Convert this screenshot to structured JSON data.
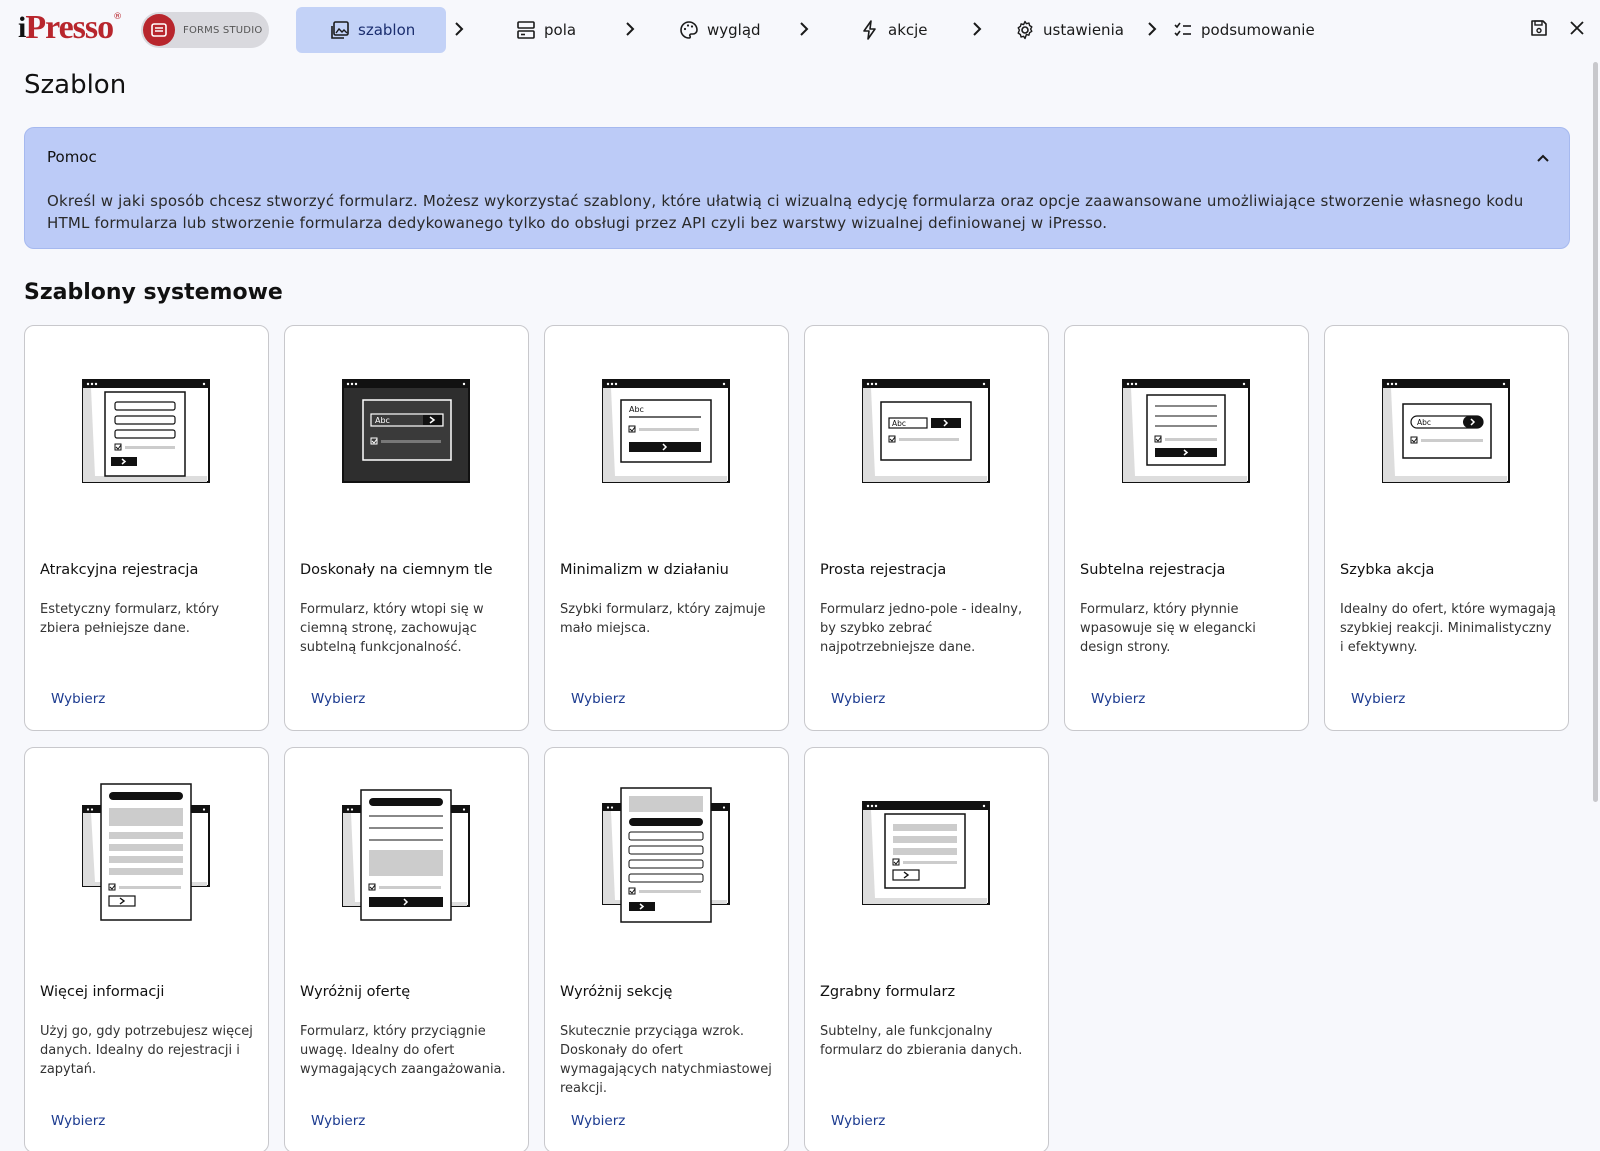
{
  "brand": {
    "logo_i": "i",
    "logo_name": "Presso",
    "logo_reg": "®",
    "studio": "FORMS STUDIO"
  },
  "steps": [
    {
      "label": "szablon",
      "icon": "image-icon",
      "active": true
    },
    {
      "label": "pola",
      "icon": "fields-icon",
      "active": false
    },
    {
      "label": "wygląd",
      "icon": "palette-icon",
      "active": false
    },
    {
      "label": "akcje",
      "icon": "lightning-icon",
      "active": false
    },
    {
      "label": "ustawienia",
      "icon": "gear-icon",
      "active": false
    },
    {
      "label": "podsumowanie",
      "icon": "checklist-icon",
      "active": false
    }
  ],
  "toolbar": {
    "save_icon": "save-icon",
    "close_icon": "close-icon"
  },
  "page_title": "Szablon",
  "help": {
    "title": "Pomoc",
    "body": "Określ w jaki sposób chcesz stworzyć formularz. Możesz wykorzystać szablony, które ułatwią ci wizualną edycję formularza oraz opcje zaawansowane umożliwiające stworzenie własnego kodu HTML formularza lub stworzenie formularza dedykowanego tylko do obsługi przez API czyli bez warstwy wizualnej definiowanej w iPresso."
  },
  "section_title": "Szablony systemowe",
  "pick_label": "Wybierz",
  "thumb_text": "Abc",
  "templates": [
    {
      "name": "Atrakcyjna rejestracja",
      "desc": "Estetyczny formularz, który zbiera pełniejsze dane."
    },
    {
      "name": "Doskonały na ciemnym tle",
      "desc": "Formularz, który wtopi się w ciemną stronę, zachowując subtelną funkcjonalność."
    },
    {
      "name": "Minimalizm w działaniu",
      "desc": "Szybki formularz, który zajmuje mało miejsca."
    },
    {
      "name": "Prosta rejestracja",
      "desc": "Formularz jedno-pole - idealny, by szybko zebrać najpotrzebniejsze dane."
    },
    {
      "name": "Subtelna rejestracja",
      "desc": "Formularz, który płynnie wpasowuje się w elegancki design strony."
    },
    {
      "name": "Szybka akcja",
      "desc": "Idealny do ofert, które wymagają szybkiej reakcji. Minimalistyczny i efektywny."
    },
    {
      "name": "Więcej informacji",
      "desc": "Użyj go, gdy potrzebujesz więcej danych. Idealny do rejestracji i zapytań."
    },
    {
      "name": "Wyróżnij ofertę",
      "desc": "Formularz, który przyciągnie uwagę. Idealny do ofert wymagających zaangażowania."
    },
    {
      "name": "Wyróżnij sekcję",
      "desc": "Skutecznie przyciąga wzrok. Doskonały do ofert wymagających natychmiastowej reakcji."
    },
    {
      "name": "Zgrabny formularz",
      "desc": "Subtelny, ale funkcjonalny formularz do zbierania danych."
    }
  ],
  "colors": {
    "accent": "#c3d2f7",
    "help_bg": "#bccbf7",
    "brand_red": "#b8262d",
    "link": "#1b3a8f"
  }
}
